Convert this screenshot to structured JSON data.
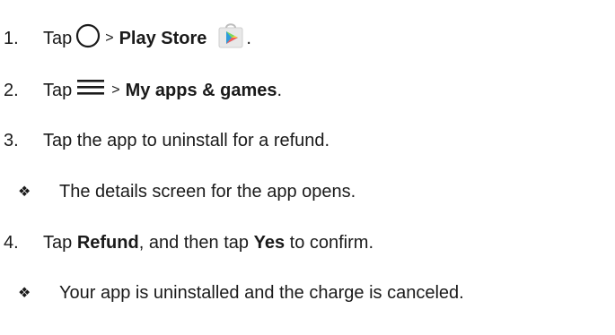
{
  "steps": [
    {
      "num": "1.",
      "tap": "Tap",
      "gt": ">",
      "bold": "Play Store",
      "after": "."
    },
    {
      "num": "2.",
      "tap": "Tap",
      "gt": ">",
      "bold": "My apps & games",
      "after": "."
    },
    {
      "num": "3.",
      "text": "Tap the app to uninstall for a refund."
    },
    {
      "bullet": "❖",
      "text": "The details screen for the app opens."
    },
    {
      "num": "4.",
      "pre": "Tap",
      "bold1": "Refund",
      "mid": ", and then tap",
      "bold2": "Yes",
      "post": "to confirm."
    },
    {
      "bullet": "❖",
      "text": "Your app is uninstalled and the charge is canceled."
    }
  ],
  "icons": {
    "step1_first": "home-circle-icon",
    "step1_second": "play-store-icon",
    "step2_first": "menu-icon"
  }
}
